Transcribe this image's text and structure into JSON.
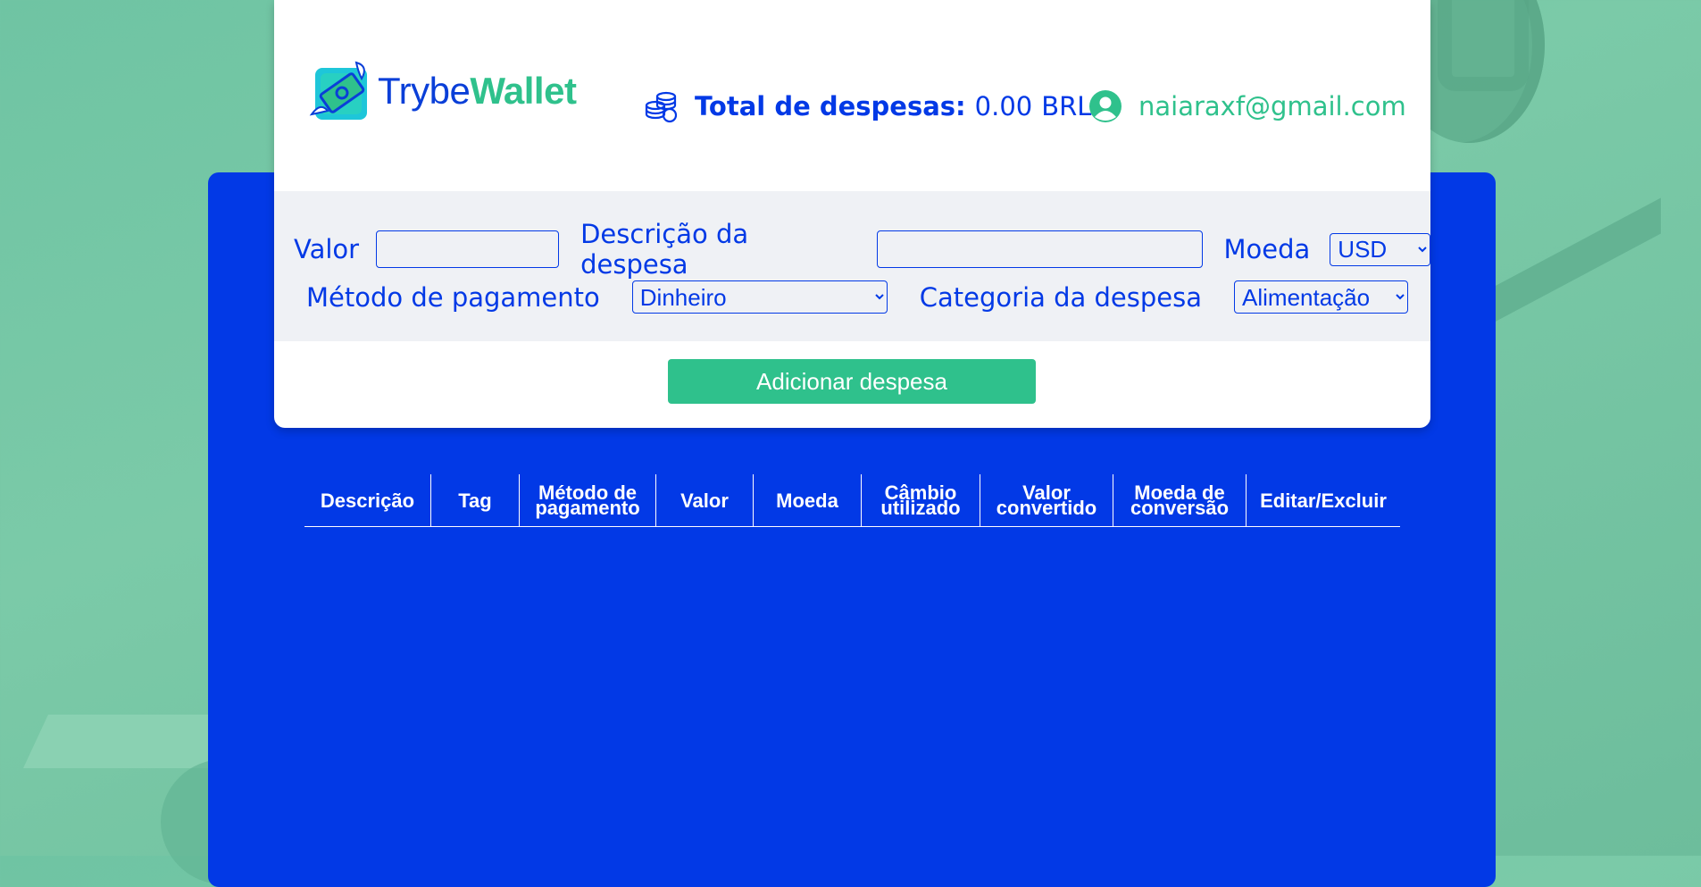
{
  "brand": {
    "name_part1": "Trybe",
    "name_part2": "Wallet"
  },
  "header": {
    "total_label": "Total de despesas:",
    "total_value": "0.00",
    "currency": "BRL",
    "email": "naiaraxf@gmail.com"
  },
  "form": {
    "value_label": "Valor",
    "value_input": "",
    "description_label": "Descrição da despesa",
    "description_input": "",
    "currency_label": "Moeda",
    "currency_selected": "USD",
    "method_label": "Método de pagamento",
    "method_selected": "Dinheiro",
    "category_label": "Categoria da despesa",
    "category_selected": "Alimentação",
    "submit_label": "Adicionar despesa"
  },
  "table": {
    "headers": [
      "Descrição",
      "Tag",
      "Método de pagamento",
      "Valor",
      "Moeda",
      "Câmbio utilizado",
      "Valor convertido",
      "Moeda de conversão",
      "Editar/Excluir"
    ],
    "rows": []
  },
  "colors": {
    "primary_blue": "#0239e6",
    "accent_green": "#2fc18c",
    "form_background": "#eff1f5",
    "page_background": "#74c5a3"
  },
  "icons": {
    "logo": "wallet-logo-icon",
    "total": "coins-icon",
    "user": "user-avatar-icon"
  }
}
